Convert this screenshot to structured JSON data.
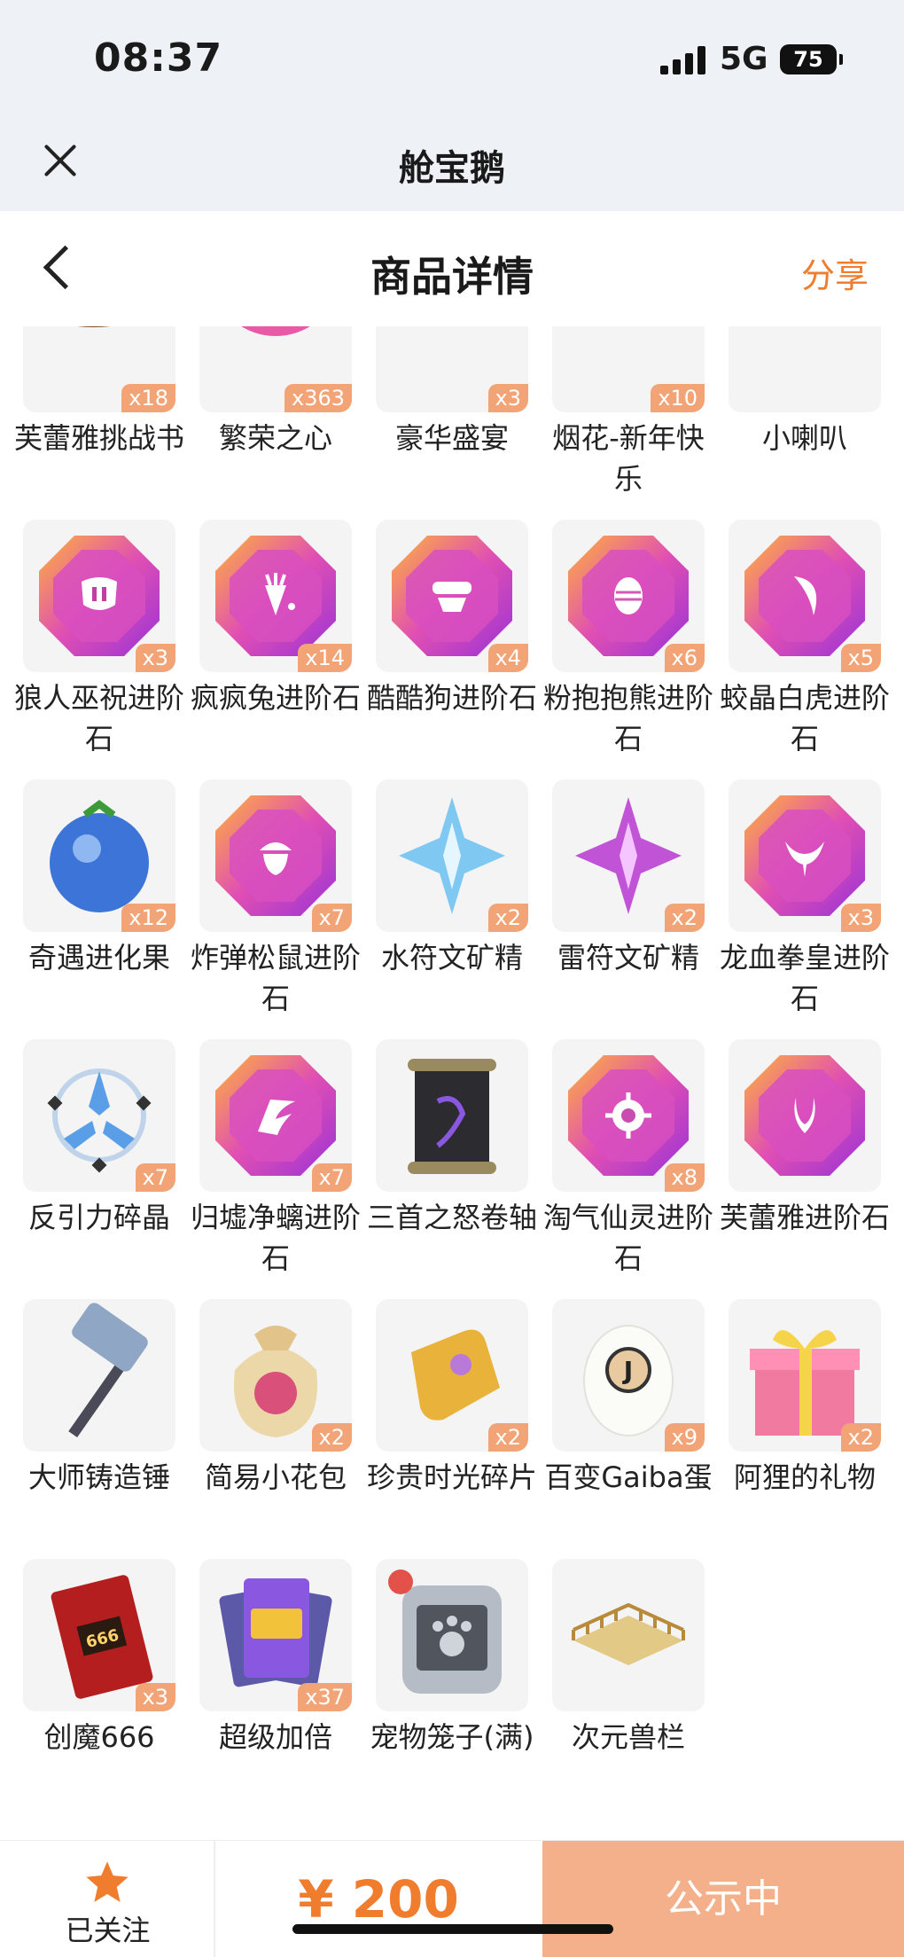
{
  "status_bar": {
    "time": "08:37",
    "network": "5G",
    "battery": "75"
  },
  "app": {
    "title": "舱宝鹅"
  },
  "header": {
    "title": "商品详情",
    "share": "分享"
  },
  "items": [
    {
      "name": "芙蕾雅挑战书",
      "qty": "x18",
      "icon": "challenge-book-icon"
    },
    {
      "name": "繁荣之心",
      "qty": "x363",
      "icon": "pink-orb-icon"
    },
    {
      "name": "豪华盛宴",
      "qty": "x3",
      "icon": "feast-bowl-icon"
    },
    {
      "name": "烟花-新年快乐",
      "qty": "x10",
      "icon": "firework-icon"
    },
    {
      "name": "小喇叭",
      "qty": "",
      "icon": "megaphone-icon"
    },
    {
      "name": "狼人巫祝进阶石",
      "qty": "x3",
      "icon": "gem-mask-icon"
    },
    {
      "name": "疯疯兔进阶石",
      "qty": "x14",
      "icon": "gem-carrot-icon"
    },
    {
      "name": "酷酷狗进阶石",
      "qty": "x4",
      "icon": "gem-goggles-icon"
    },
    {
      "name": "粉抱抱熊进阶石",
      "qty": "x6",
      "icon": "gem-egg-icon"
    },
    {
      "name": "蛟晶白虎进阶石",
      "qty": "x5",
      "icon": "gem-claw-icon"
    },
    {
      "name": "奇遇进化果",
      "qty": "x12",
      "icon": "blue-fruit-icon"
    },
    {
      "name": "炸弹松鼠进阶石",
      "qty": "x7",
      "icon": "gem-acorn-icon"
    },
    {
      "name": "水符文矿精",
      "qty": "x2",
      "icon": "blue-crystal-icon"
    },
    {
      "name": "雷符文矿精",
      "qty": "x2",
      "icon": "purple-crystal-icon"
    },
    {
      "name": "龙血拳皇进阶石",
      "qty": "x3",
      "icon": "gem-horns-icon"
    },
    {
      "name": "反引力碎晶",
      "qty": "x7",
      "icon": "antigravity-shard-icon"
    },
    {
      "name": "归墟净螭进阶石",
      "qty": "x7",
      "icon": "gem-wing-icon"
    },
    {
      "name": "三首之怒卷轴",
      "qty": "",
      "icon": "scroll-icon"
    },
    {
      "name": "淘气仙灵进阶石",
      "qty": "x8",
      "icon": "gem-spirit-icon"
    },
    {
      "name": "芙蕾雅进阶石",
      "qty": "",
      "icon": "gem-freya-icon"
    },
    {
      "name": "大师铸造锤",
      "qty": "",
      "icon": "hammer-icon"
    },
    {
      "name": "简易小花包",
      "qty": "x2",
      "icon": "flower-bag-icon"
    },
    {
      "name": "珍贵时光碎片",
      "qty": "x2",
      "icon": "puzzle-piece-icon"
    },
    {
      "name": "百变Gaiba蛋",
      "qty": "x9",
      "icon": "egg-icon"
    },
    {
      "name": "阿狸的礼物",
      "qty": "x2",
      "icon": "gift-box-icon"
    },
    {
      "name": "创魔666",
      "qty": "x3",
      "icon": "card-666-icon"
    },
    {
      "name": "超级加倍",
      "qty": "x37",
      "icon": "double-cards-icon"
    },
    {
      "name": "宠物笼子(满)",
      "qty": "",
      "icon": "pet-cage-icon"
    },
    {
      "name": "次元兽栏",
      "qty": "",
      "icon": "fence-icon"
    }
  ],
  "bottom_bar": {
    "follow_label": "已关注",
    "price": "¥ 200",
    "status_button": "公示中"
  },
  "colors": {
    "accent": "#f07c2e",
    "badge": "#f2a477",
    "button": "#f4b08a",
    "tile": "#f4f4f4"
  }
}
